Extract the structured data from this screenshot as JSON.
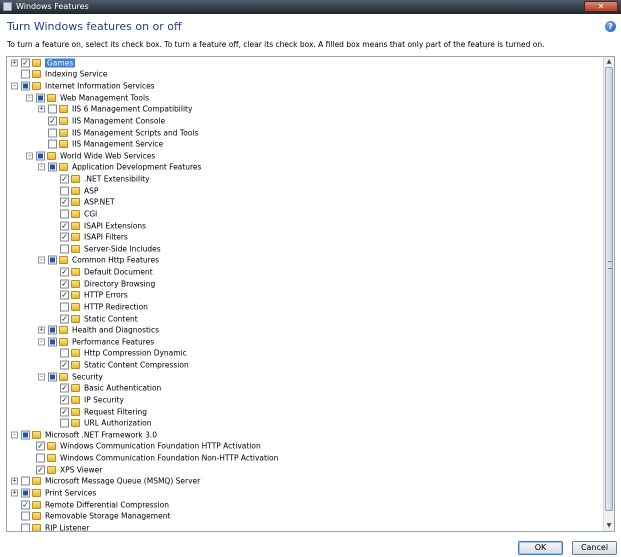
{
  "window": {
    "title": "Windows Features",
    "close_label": "✕"
  },
  "dialog": {
    "heading": "Turn Windows features on or off",
    "help_label": "?",
    "instructions": "To turn a feature on, select its check box. To turn a feature off, clear its check box. A filled box means that only part of the feature is turned on."
  },
  "tree": {
    "items": [
      {
        "label": "Games",
        "level": 0,
        "expander": "+",
        "state": "checked",
        "selected": true
      },
      {
        "label": "Indexing Service",
        "level": 0,
        "expander": "",
        "state": "unchecked"
      },
      {
        "label": "Internet Information Services",
        "level": 0,
        "expander": "-",
        "state": "partial"
      },
      {
        "label": "Web Management Tools",
        "level": 1,
        "expander": "-",
        "state": "partial"
      },
      {
        "label": "IIS 6 Management Compatibility",
        "level": 2,
        "expander": "+",
        "state": "unchecked"
      },
      {
        "label": "IIS Management Console",
        "level": 2,
        "expander": "",
        "state": "checked"
      },
      {
        "label": "IIS Management Scripts and Tools",
        "level": 2,
        "expander": "",
        "state": "unchecked"
      },
      {
        "label": "IIS Management Service",
        "level": 2,
        "expander": "",
        "state": "unchecked"
      },
      {
        "label": "World Wide Web Services",
        "level": 1,
        "expander": "-",
        "state": "partial"
      },
      {
        "label": "Application Development Features",
        "level": 2,
        "expander": "-",
        "state": "partial"
      },
      {
        "label": ".NET Extensibility",
        "level": 3,
        "expander": "",
        "state": "checked"
      },
      {
        "label": "ASP",
        "level": 3,
        "expander": "",
        "state": "unchecked"
      },
      {
        "label": "ASP.NET",
        "level": 3,
        "expander": "",
        "state": "checked"
      },
      {
        "label": "CGI",
        "level": 3,
        "expander": "",
        "state": "unchecked"
      },
      {
        "label": "ISAPI Extensions",
        "level": 3,
        "expander": "",
        "state": "checked"
      },
      {
        "label": "ISAPI Filters",
        "level": 3,
        "expander": "",
        "state": "checked"
      },
      {
        "label": "Server-Side Includes",
        "level": 3,
        "expander": "",
        "state": "unchecked"
      },
      {
        "label": "Common Http Features",
        "level": 2,
        "expander": "-",
        "state": "partial"
      },
      {
        "label": "Default Document",
        "level": 3,
        "expander": "",
        "state": "checked"
      },
      {
        "label": "Directory Browsing",
        "level": 3,
        "expander": "",
        "state": "checked"
      },
      {
        "label": "HTTP Errors",
        "level": 3,
        "expander": "",
        "state": "checked"
      },
      {
        "label": "HTTP Redirection",
        "level": 3,
        "expander": "",
        "state": "unchecked"
      },
      {
        "label": "Static Content",
        "level": 3,
        "expander": "",
        "state": "checked"
      },
      {
        "label": "Health and Diagnostics",
        "level": 2,
        "expander": "+",
        "state": "partial"
      },
      {
        "label": "Performance Features",
        "level": 2,
        "expander": "-",
        "state": "partial"
      },
      {
        "label": "Http Compression Dynamic",
        "level": 3,
        "expander": "",
        "state": "unchecked"
      },
      {
        "label": "Static Content Compression",
        "level": 3,
        "expander": "",
        "state": "checked"
      },
      {
        "label": "Security",
        "level": 2,
        "expander": "-",
        "state": "partial"
      },
      {
        "label": "Basic Authentication",
        "level": 3,
        "expander": "",
        "state": "checked"
      },
      {
        "label": "IP Security",
        "level": 3,
        "expander": "",
        "state": "checked"
      },
      {
        "label": "Request Filtering",
        "level": 3,
        "expander": "",
        "state": "checked"
      },
      {
        "label": "URL Authorization",
        "level": 3,
        "expander": "",
        "state": "unchecked"
      },
      {
        "label": "Microsoft .NET Framework 3.0",
        "level": 0,
        "expander": "-",
        "state": "partial"
      },
      {
        "label": "Windows Communication Foundation HTTP Activation",
        "level": 1,
        "expander": "",
        "state": "checked"
      },
      {
        "label": "Windows Communication Foundation Non-HTTP Activation",
        "level": 1,
        "expander": "",
        "state": "unchecked"
      },
      {
        "label": "XPS Viewer",
        "level": 1,
        "expander": "",
        "state": "checked"
      },
      {
        "label": "Microsoft Message Queue (MSMQ) Server",
        "level": 0,
        "expander": "+",
        "state": "unchecked"
      },
      {
        "label": "Print Services",
        "level": 0,
        "expander": "+",
        "state": "partial"
      },
      {
        "label": "Remote Differential Compression",
        "level": 0,
        "expander": "",
        "state": "checked"
      },
      {
        "label": "Removable Storage Management",
        "level": 0,
        "expander": "",
        "state": "unchecked"
      },
      {
        "label": "RIP Listener",
        "level": 0,
        "expander": "",
        "state": "unchecked"
      }
    ]
  },
  "buttons": {
    "ok": "OK",
    "cancel": "Cancel"
  }
}
